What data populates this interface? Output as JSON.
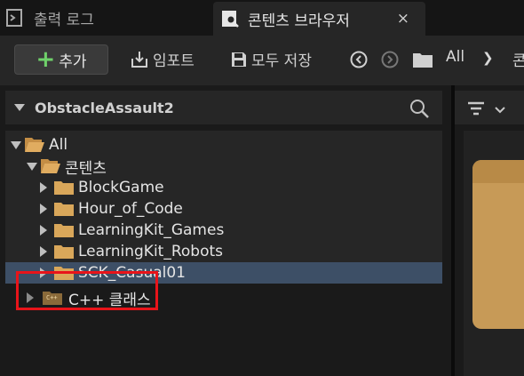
{
  "tabs": {
    "output_log": "출력 로그",
    "content_browser": "콘텐츠 브라우저",
    "close_glyph": "×"
  },
  "toolbar": {
    "add_label": "추가",
    "import_label": "임포트",
    "save_all_label": "모두 저장",
    "breadcrumb": [
      "All",
      "콘"
    ]
  },
  "panel": {
    "title": "ObstacleAssault2"
  },
  "tree": {
    "items": [
      {
        "label": "All",
        "expanded": true
      },
      {
        "label": "콘텐츠",
        "expanded": true
      },
      {
        "label": "BlockGame"
      },
      {
        "label": "Hour_of_Code"
      },
      {
        "label": "LearningKit_Games"
      },
      {
        "label": "LearningKit_Robots"
      },
      {
        "label": "SCK_Casual01",
        "selected": true
      }
    ],
    "cpp_classes": "C++ 클래스",
    "cpp_icon_text": "C++"
  },
  "colors": {
    "accent_add": "#6fd16a",
    "selected_row": "#3d4f66",
    "highlight_box": "#e8141a",
    "folder": "#d9a75a"
  }
}
